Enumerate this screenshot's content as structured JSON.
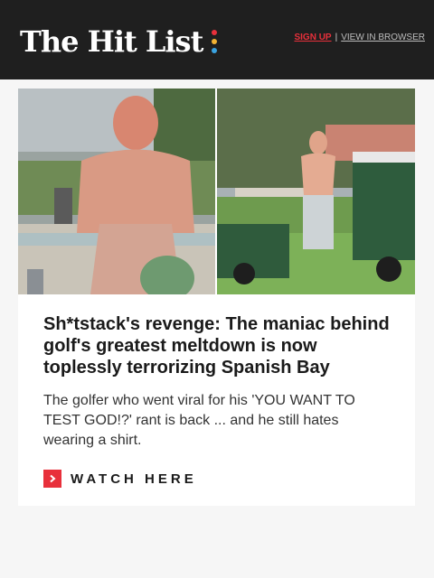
{
  "header": {
    "logo_text": "The Hit List",
    "logo_dot_colors": [
      "#e8303b",
      "#f2b233",
      "#3aa3e0"
    ],
    "signup_label": "SIGN UP",
    "separator": "|",
    "view_in_browser_label": "VIEW IN BROWSER"
  },
  "article": {
    "image_description_icon": "photo-collage",
    "headline": "Sh*tstack's revenge: The maniac behind golf's greatest meltdown is now toplessly terrorizing Spanish Bay",
    "dek": "The golfer who went viral for his 'YOU WANT TO TEST GOD!?' rant is back ... and he still hates wearing a shirt.",
    "cta_icon": "chevron-right-icon",
    "cta_label": "WATCH HERE"
  },
  "colors": {
    "accent": "#e8303b",
    "header_bg": "#1f1f1f",
    "page_bg": "#f6f6f6"
  }
}
